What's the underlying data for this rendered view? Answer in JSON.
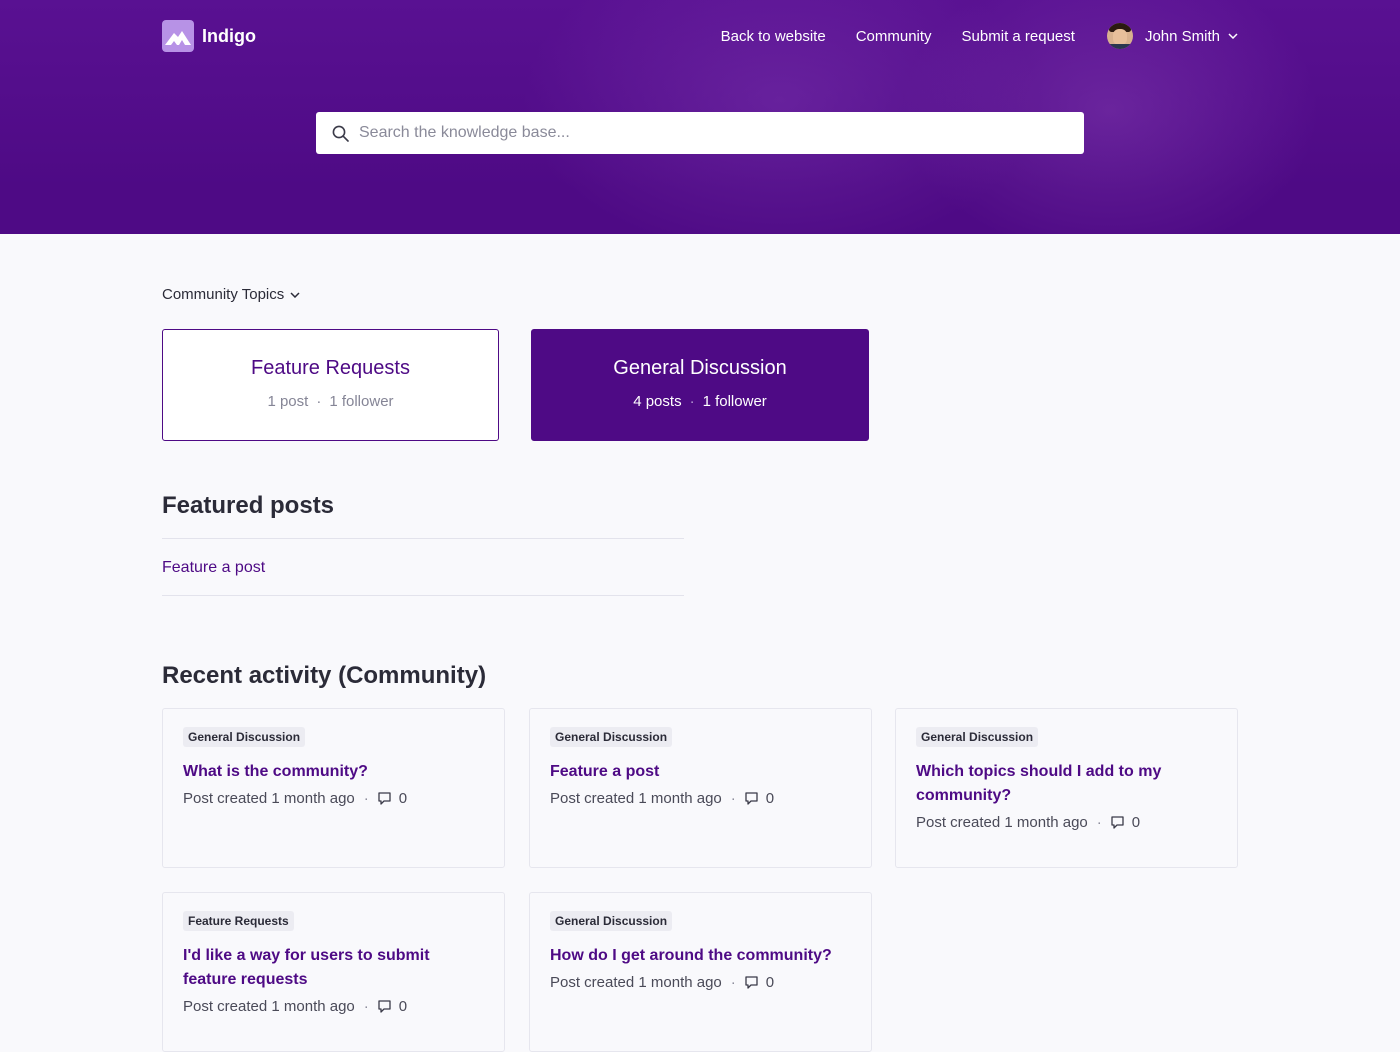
{
  "header": {
    "brand": "Indigo",
    "nav": [
      {
        "label": "Back to website"
      },
      {
        "label": "Community"
      },
      {
        "label": "Submit a request"
      }
    ],
    "user_name": "John Smith",
    "search_placeholder": "Search the knowledge base..."
  },
  "topics": {
    "toggle_label": "Community Topics",
    "items": [
      {
        "title": "Feature Requests",
        "posts": "1 post",
        "followers": "1 follower"
      },
      {
        "title": "General Discussion",
        "posts": "4 posts",
        "followers": "1 follower"
      }
    ]
  },
  "featured": {
    "title": "Featured posts",
    "link": "Feature a post"
  },
  "recent": {
    "title": "Recent activity (Community)",
    "posts": [
      {
        "topic": "General Discussion",
        "title": "What is the community?",
        "meta": "Post created 1 month ago",
        "comments": "0"
      },
      {
        "topic": "General Discussion",
        "title": "Feature a post",
        "meta": "Post created 1 month ago",
        "comments": "0"
      },
      {
        "topic": "General Discussion",
        "title": "Which topics should I add to my community?",
        "meta": "Post created 1 month ago",
        "comments": "0"
      },
      {
        "topic": "Feature Requests",
        "title": "I'd like a way for users to submit feature requests",
        "meta": "Post created 1 month ago",
        "comments": "0"
      },
      {
        "topic": "General Discussion",
        "title": "How do I get around the community?",
        "meta": "Post created 1 month ago",
        "comments": "0"
      }
    ]
  },
  "colors": {
    "brand": "#4e0a85",
    "background": "#f9f9fc"
  }
}
